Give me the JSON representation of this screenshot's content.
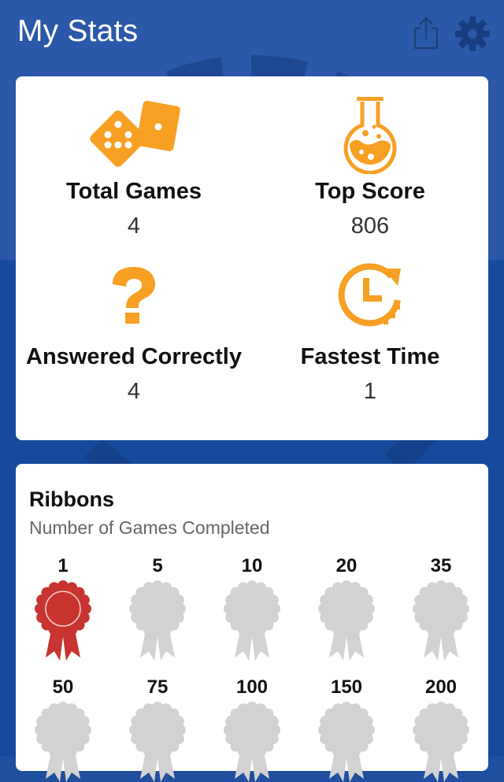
{
  "header": {
    "title": "My Stats",
    "share_icon": "share-icon",
    "settings_icon": "gear-icon"
  },
  "stats": [
    {
      "label": "Total Games",
      "value": "4",
      "icon": "dice-icon"
    },
    {
      "label": "Top Score",
      "value": "806",
      "icon": "flask-icon"
    },
    {
      "label": "Answered Correctly",
      "value": "4",
      "icon": "question-icon"
    },
    {
      "label": "Fastest Time",
      "value": "1",
      "icon": "clock-icon"
    }
  ],
  "ribbons": {
    "title": "Ribbons",
    "subtitle": "Number of Games Completed",
    "items": [
      {
        "label": "1",
        "earned": true
      },
      {
        "label": "5",
        "earned": false
      },
      {
        "label": "10",
        "earned": false
      },
      {
        "label": "20",
        "earned": false
      },
      {
        "label": "35",
        "earned": false
      },
      {
        "label": "50",
        "earned": false
      },
      {
        "label": "75",
        "earned": false
      },
      {
        "label": "100",
        "earned": false
      },
      {
        "label": "150",
        "earned": false
      },
      {
        "label": "200",
        "earned": false
      }
    ]
  },
  "colors": {
    "accent": "#f7a024",
    "header_bg": "#2b58a8",
    "earned_ribbon": "#c8342f",
    "locked_ribbon": "#d2d2d2"
  }
}
